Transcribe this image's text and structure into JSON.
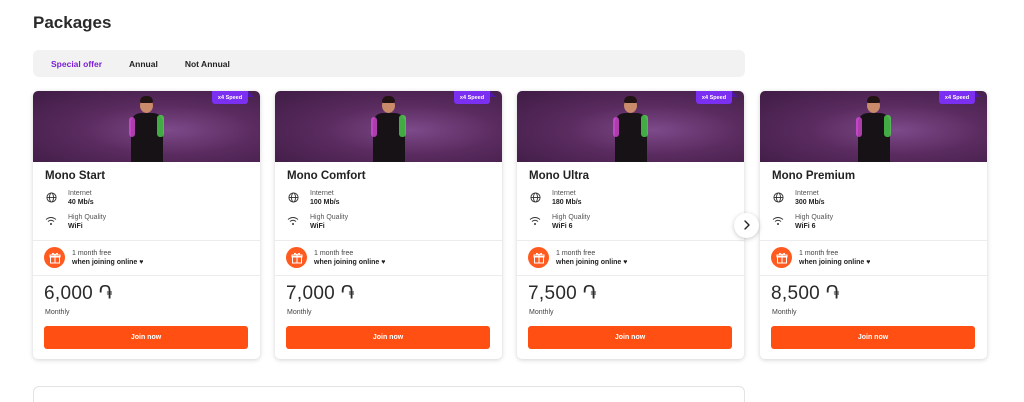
{
  "page": {
    "title": "Packages"
  },
  "tabs": [
    {
      "label": "Special offer",
      "active": true
    },
    {
      "label": "Annual",
      "active": false
    },
    {
      "label": "Not Annual",
      "active": false
    }
  ],
  "colors": {
    "accent": "#ff4f12",
    "active_tab": "#7a1fd6",
    "badge": "#7b2ff0"
  },
  "cards": [
    {
      "badge": "x4 Speed",
      "name": "Mono Start",
      "features": [
        {
          "icon": "globe-icon",
          "label": "Internet",
          "value": "40 Mb/s"
        },
        {
          "icon": "wifi-icon",
          "label": "High Quality",
          "value": "WiFi"
        }
      ],
      "promo_line1": "1 month free",
      "promo_line2": "when joining online ♥",
      "price": "6,000 ֏",
      "period": "Monthly",
      "cta": "Join now"
    },
    {
      "badge": "x4 Speed",
      "name": "Mono Comfort",
      "features": [
        {
          "icon": "globe-icon",
          "label": "Internet",
          "value": "100 Mb/s"
        },
        {
          "icon": "wifi-icon",
          "label": "High Quality",
          "value": "WiFi"
        }
      ],
      "promo_line1": "1 month free",
      "promo_line2": "when joining online ♥",
      "price": "7,000 ֏",
      "period": "Monthly",
      "cta": "Join now"
    },
    {
      "badge": "x4 Speed",
      "name": "Mono Ultra",
      "features": [
        {
          "icon": "globe-icon",
          "label": "Internet",
          "value": "180 Mb/s"
        },
        {
          "icon": "wifi-icon",
          "label": "High Quality",
          "value": "WiFi 6"
        }
      ],
      "promo_line1": "1 month free",
      "promo_line2": "when joining online ♥",
      "price": "7,500 ֏",
      "period": "Monthly",
      "cta": "Join now"
    },
    {
      "badge": "x4 Speed",
      "name": "Mono Premium",
      "features": [
        {
          "icon": "globe-icon",
          "label": "Internet",
          "value": "300 Mb/s"
        },
        {
          "icon": "wifi-icon",
          "label": "High Quality",
          "value": "WiFi 6"
        }
      ],
      "promo_line1": "1 month free",
      "promo_line2": "when joining online ♥",
      "price": "8,500 ֏",
      "period": "Monthly",
      "cta": "Join now"
    }
  ],
  "carousel": {
    "next_icon": "chevron-right-icon"
  }
}
